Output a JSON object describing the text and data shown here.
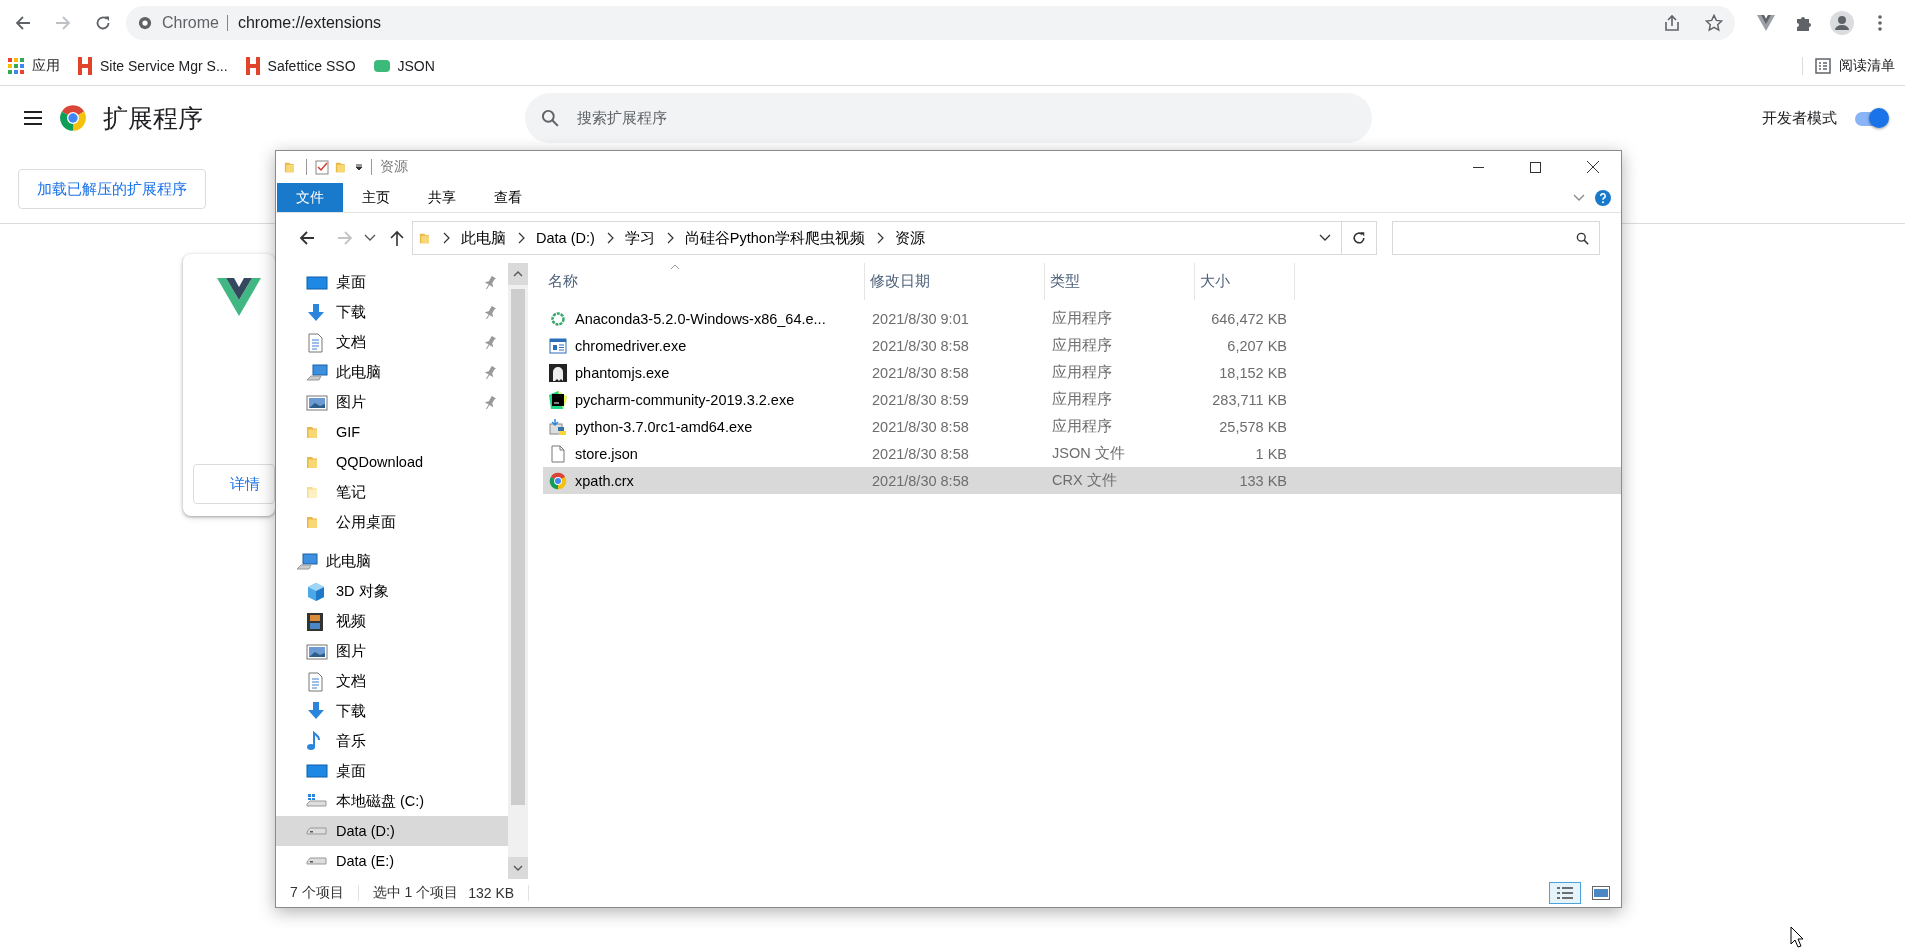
{
  "browser": {
    "address": {
      "scheme_label": "Chrome",
      "url": "chrome://extensions"
    },
    "bookmarks": [
      {
        "label": "应用",
        "kind": "apps"
      },
      {
        "label": "Site Service Mgr S...",
        "kind": "h"
      },
      {
        "label": "Safettice SSO",
        "kind": "h"
      },
      {
        "label": "JSON",
        "kind": "json"
      }
    ],
    "reading_list": "阅读清单"
  },
  "extensions_page": {
    "title": "扩展程序",
    "search": {
      "placeholder": "搜索扩展程序"
    },
    "developer_mode": {
      "label": "开发者模式",
      "on": true
    },
    "buttons": [
      "加载已解压的扩展程序"
    ],
    "card": {
      "button": "详情"
    }
  },
  "explorer": {
    "title": "资源",
    "ribbon_tabs": [
      {
        "label": "文件",
        "selected": true
      },
      {
        "label": "主页",
        "selected": false
      },
      {
        "label": "共享",
        "selected": false
      },
      {
        "label": "查看",
        "selected": false
      }
    ],
    "breadcrumb": [
      "此电脑",
      "Data (D:)",
      "学习",
      "尚硅谷Python学科爬虫视频",
      "资源"
    ],
    "quick_access": [
      {
        "label": "桌面",
        "kind": "desktop",
        "pinned": true,
        "selected": false
      },
      {
        "label": "下载",
        "kind": "download",
        "pinned": true,
        "selected": false
      },
      {
        "label": "文档",
        "kind": "document",
        "pinned": true,
        "selected": false
      },
      {
        "label": "此电脑",
        "kind": "computer",
        "pinned": true,
        "selected": false
      },
      {
        "label": "图片",
        "kind": "picture",
        "pinned": true,
        "selected": false
      },
      {
        "label": "GIF",
        "kind": "folder",
        "pinned": false,
        "selected": false
      },
      {
        "label": "QQDownload",
        "kind": "folder",
        "pinned": false,
        "selected": false
      },
      {
        "label": "笔记",
        "kind": "folder-light",
        "pinned": false,
        "selected": false
      },
      {
        "label": "公用桌面",
        "kind": "folder",
        "pinned": false,
        "selected": false
      }
    ],
    "this_pc": {
      "label": "此电脑",
      "kind": "computer",
      "selected": false,
      "children": [
        {
          "label": "3D 对象",
          "kind": "cube",
          "selected": false
        },
        {
          "label": "视频",
          "kind": "film",
          "selected": false
        },
        {
          "label": "图片",
          "kind": "picture",
          "selected": false
        },
        {
          "label": "文档",
          "kind": "document",
          "selected": false
        },
        {
          "label": "下载",
          "kind": "download",
          "selected": false
        },
        {
          "label": "音乐",
          "kind": "music",
          "selected": false
        },
        {
          "label": "桌面",
          "kind": "desktop",
          "selected": false
        },
        {
          "label": "本地磁盘 (C:)",
          "kind": "windows-drive",
          "selected": false
        },
        {
          "label": "Data (D:)",
          "kind": "drive",
          "selected": true
        },
        {
          "label": "Data (E:)",
          "kind": "drive",
          "selected": false
        }
      ]
    },
    "columns": [
      "名称",
      "修改日期",
      "类型",
      "大小"
    ],
    "files": [
      {
        "name": "Anaconda3-5.2.0-Windows-x86_64.e...",
        "date": "2021/8/30 9:01",
        "type": "应用程序",
        "size": "646,472 KB",
        "kind": "ring",
        "selected": false
      },
      {
        "name": "chromedriver.exe",
        "date": "2021/8/30 8:58",
        "type": "应用程序",
        "size": "6,207 KB",
        "kind": "window",
        "selected": false
      },
      {
        "name": "phantomjs.exe",
        "date": "2021/8/30 8:58",
        "type": "应用程序",
        "size": "18,152 KB",
        "kind": "ghost",
        "selected": false
      },
      {
        "name": "pycharm-community-2019.3.2.exe",
        "date": "2021/8/30 8:59",
        "type": "应用程序",
        "size": "283,711 KB",
        "kind": "ide",
        "selected": false
      },
      {
        "name": "python-3.7.0rc1-amd64.exe",
        "date": "2021/8/30 8:58",
        "type": "应用程序",
        "size": "25,578 KB",
        "kind": "installer",
        "selected": false
      },
      {
        "name": "store.json",
        "date": "2021/8/30 8:58",
        "type": "JSON 文件",
        "size": "1 KB",
        "kind": "document",
        "selected": false
      },
      {
        "name": "xpath.crx",
        "date": "2021/8/30 8:58",
        "type": "CRX 文件",
        "size": "133 KB",
        "kind": "chrome",
        "selected": true
      }
    ],
    "status": {
      "count": "7 个项目",
      "selection": "选中 1 个项目",
      "size": "132 KB"
    },
    "views": [
      {
        "kind": "details",
        "selected": true
      },
      {
        "kind": "tiles",
        "selected": false
      }
    ]
  }
}
